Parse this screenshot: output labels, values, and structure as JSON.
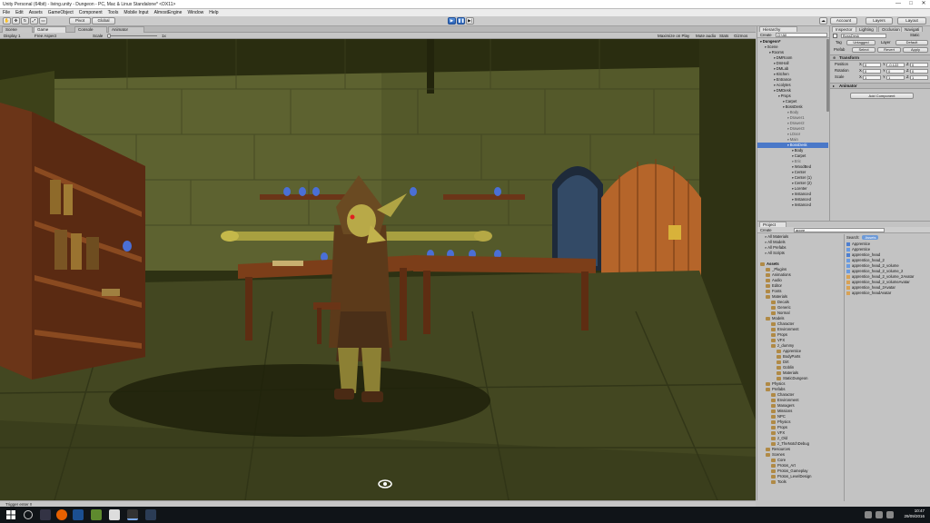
{
  "window": {
    "title": "Unity Personal (64bit) - living.unity - Dungeon - PC, Mac & Linux Standalone* <DX11>",
    "min": "—",
    "max": "□",
    "close": "✕"
  },
  "menu": [
    "File",
    "Edit",
    "Assets",
    "GameObject",
    "Component",
    "Tools",
    "Mobile Input",
    "AlmostEngine",
    "Window",
    "Help"
  ],
  "toolbar": {
    "pivot": "Pivot",
    "global": "Global",
    "account": "Account",
    "layers": "Layers",
    "layout": "Layout"
  },
  "scene_tabs": {
    "scene": "Scene",
    "game": "Game",
    "console": "Console",
    "animator": "Animator"
  },
  "game_bar": {
    "display": "Display 1",
    "aspect": "Free Aspect",
    "scale_label": "Scale",
    "scale_value": "1x",
    "maximize": "Maximize on Play",
    "mute": "Mute audio",
    "stats": "Stats",
    "gizmos": "Gizmos"
  },
  "status": {
    "message": "Trigger enter !!"
  },
  "hierarchy": {
    "tab": "Hierarchy",
    "create": "Create",
    "search": "Q+All",
    "items": [
      {
        "label": "Dungeon*",
        "indent": 0,
        "bold": true
      },
      {
        "label": "Scene",
        "indent": 1
      },
      {
        "label": "Rooms",
        "indent": 2
      },
      {
        "label": "DMRoom",
        "indent": 3
      },
      {
        "label": "DmHall",
        "indent": 3
      },
      {
        "label": "DMLab",
        "indent": 3
      },
      {
        "label": "Kitchen",
        "indent": 3
      },
      {
        "label": "Entrance",
        "indent": 3
      },
      {
        "label": "Acolytes",
        "indent": 3
      },
      {
        "label": "DMDesk",
        "indent": 3
      },
      {
        "label": "Props",
        "indent": 4
      },
      {
        "label": "Carpet",
        "indent": 5
      },
      {
        "label": "BossDesk",
        "indent": 5
      },
      {
        "label": "Body",
        "indent": 6,
        "grey": true
      },
      {
        "label": "Drawer1",
        "indent": 6,
        "grey": true
      },
      {
        "label": "Drawer2",
        "indent": 6,
        "grey": true
      },
      {
        "label": "Drawer3",
        "indent": 6,
        "grey": true
      },
      {
        "label": "LDoor",
        "indent": 6,
        "grey": true
      },
      {
        "label": "Main",
        "indent": 6,
        "grey": true
      },
      {
        "label": "BossDesk",
        "indent": 6,
        "selected": true
      },
      {
        "label": "Body",
        "indent": 7
      },
      {
        "label": "Carpet",
        "indent": 7
      },
      {
        "label": "Eric",
        "indent": 7,
        "grey": true
      },
      {
        "label": "WoodBed",
        "indent": 7
      },
      {
        "label": "Center",
        "indent": 7
      },
      {
        "label": "Center (1)",
        "indent": 7
      },
      {
        "label": "Center (2)",
        "indent": 7
      },
      {
        "label": "Lcenter",
        "indent": 7
      },
      {
        "label": "Instanced",
        "indent": 7
      },
      {
        "label": "Instanced",
        "indent": 7
      },
      {
        "label": "Instanced",
        "indent": 7
      }
    ]
  },
  "inspector": {
    "tabs": [
      "Inspector",
      "Lighting",
      "Occlusion",
      "Navigati"
    ],
    "object_name": "BossDesk",
    "static": "Static",
    "tag_label": "Tag",
    "tag_value": "Untagged",
    "layer_label": "Layer",
    "layer_value": "Default",
    "prefab_label": "Prefab",
    "prefab_select": "Select",
    "prefab_revert": "Revert",
    "prefab_apply": "Apply",
    "transform_title": "Transform",
    "position_label": "Position",
    "rotation_label": "Rotation",
    "scale_label": "Scale",
    "pos": {
      "x": "0",
      "y": "-0.122",
      "z": "0"
    },
    "rot": {
      "x": "0",
      "y": "0",
      "z": "0"
    },
    "scl": {
      "x": "1",
      "y": "1",
      "z": "1"
    },
    "animator_title": "Animator",
    "add_component": "Add Component"
  },
  "project": {
    "tab": "Project",
    "create": "Create",
    "search": "appre",
    "search_label": "Search:",
    "search_scope": "Assets",
    "favorites": [
      "All Materials",
      "All Models",
      "All Prefabs",
      "All Scripts"
    ],
    "tree": [
      {
        "label": "Assets",
        "indent": 0,
        "bold": true
      },
      {
        "label": "_Plugins",
        "indent": 1
      },
      {
        "label": "Animations",
        "indent": 1
      },
      {
        "label": "Audio",
        "indent": 1
      },
      {
        "label": "Editor",
        "indent": 1
      },
      {
        "label": "Fonts",
        "indent": 1
      },
      {
        "label": "Materials",
        "indent": 1
      },
      {
        "label": "Decals",
        "indent": 2
      },
      {
        "label": "Generic",
        "indent": 2
      },
      {
        "label": "Normal",
        "indent": 2
      },
      {
        "label": "Models",
        "indent": 1
      },
      {
        "label": "Character",
        "indent": 2
      },
      {
        "label": "Environment",
        "indent": 2
      },
      {
        "label": "Props",
        "indent": 2
      },
      {
        "label": "VFX",
        "indent": 2
      },
      {
        "label": "z_dummy",
        "indent": 2
      },
      {
        "label": "Apprentice",
        "indent": 3
      },
      {
        "label": "BodyParts",
        "indent": 3
      },
      {
        "label": "Dirt",
        "indent": 3
      },
      {
        "label": "Goblin",
        "indent": 3
      },
      {
        "label": "Materials",
        "indent": 3
      },
      {
        "label": "StaticDungeon",
        "indent": 3
      },
      {
        "label": "Physics",
        "indent": 1
      },
      {
        "label": "Prefabs",
        "indent": 1
      },
      {
        "label": "Character",
        "indent": 2
      },
      {
        "label": "Environment",
        "indent": 2
      },
      {
        "label": "Managers",
        "indent": 2
      },
      {
        "label": "Missions",
        "indent": 2
      },
      {
        "label": "NPC",
        "indent": 2
      },
      {
        "label": "Physics",
        "indent": 2
      },
      {
        "label": "Props",
        "indent": 2
      },
      {
        "label": "VFX",
        "indent": 2
      },
      {
        "label": "z_Old",
        "indent": 2
      },
      {
        "label": "z_TheNotchDebug",
        "indent": 2
      },
      {
        "label": "Resources",
        "indent": 1
      },
      {
        "label": "Scenes",
        "indent": 1
      },
      {
        "label": "Core",
        "indent": 2
      },
      {
        "label": "Protos_Art",
        "indent": 2
      },
      {
        "label": "Protos_Gameplay",
        "indent": 2
      },
      {
        "label": "Protos_LevelDesign",
        "indent": 2
      },
      {
        "label": "Tools",
        "indent": 2
      }
    ],
    "results": [
      {
        "label": "Apprentice",
        "kind": "prefab"
      },
      {
        "label": "Apprentice",
        "kind": "mesh"
      },
      {
        "label": "apprentice_head",
        "kind": "prefab"
      },
      {
        "label": "apprentice_head_2",
        "kind": "mesh"
      },
      {
        "label": "apprentice_head_2_volume",
        "kind": "mesh"
      },
      {
        "label": "apprentice_head_2_volume_2",
        "kind": "mesh"
      },
      {
        "label": "apprentice_head_2_volume_2Avatar",
        "kind": "anim"
      },
      {
        "label": "apprentice_head_2_volumeAvatar",
        "kind": "anim"
      },
      {
        "label": "apprentice_head_2Avatar",
        "kind": "anim"
      },
      {
        "label": "apprentice_headAvatar",
        "kind": "anim"
      }
    ]
  },
  "taskbar": {
    "time": "10:47",
    "date": "29/09/2016"
  },
  "colors": {
    "selection": "#4a78c8",
    "play_blue": "#3a74c8",
    "taskbar": "#101418"
  }
}
